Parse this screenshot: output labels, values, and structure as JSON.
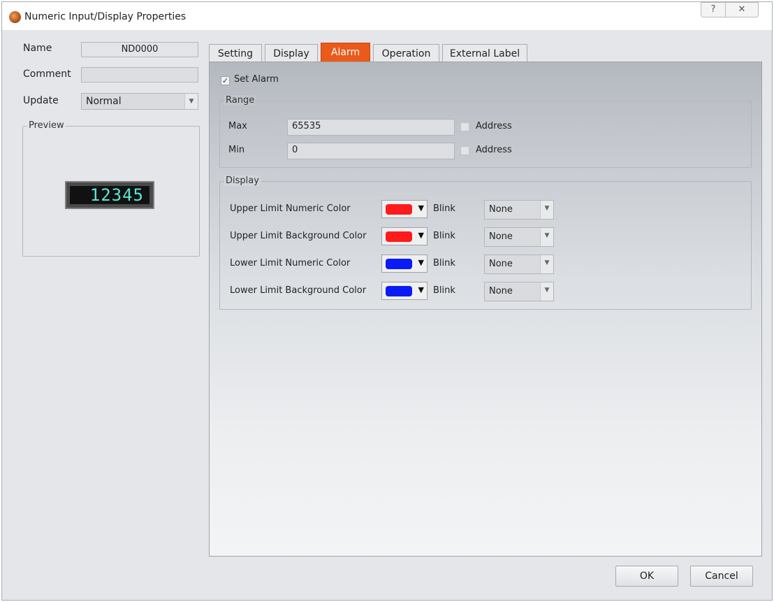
{
  "window": {
    "title": "Numeric Input/Display Properties",
    "help_glyph": "?",
    "close_glyph": "✕"
  },
  "left": {
    "name_label": "Name",
    "name_value": "ND0000",
    "comment_label": "Comment",
    "comment_value": "",
    "update_label": "Update",
    "update_value": "Normal",
    "preview_title": "Preview",
    "preview_value": "12345",
    "preview_color": "#58e7d6"
  },
  "tabs": [
    "Setting",
    "Display",
    "Alarm",
    "Operation",
    "External Label"
  ],
  "active_tab": "Alarm",
  "alarm": {
    "set_alarm_label": "Set Alarm",
    "set_alarm_checked": true,
    "range": {
      "title": "Range",
      "max_label": "Max",
      "max_value": "65535",
      "min_label": "Min",
      "min_value": "0",
      "address_label": "Address"
    },
    "display": {
      "title": "Display",
      "blink_label": "Blink",
      "rows": [
        {
          "label": "Upper Limit Numeric Color",
          "color": "#ff1b1b",
          "blink": "None"
        },
        {
          "label": "Upper Limit Background Color",
          "color": "#ff1b1b",
          "blink": "None"
        },
        {
          "label": "Lower Limit Numeric Color",
          "color": "#0a1cf5",
          "blink": "None"
        },
        {
          "label": "Lower Limit Background Color",
          "color": "#0a1cf5",
          "blink": "None"
        }
      ]
    }
  },
  "footer": {
    "ok_label": "OK",
    "cancel_label": "Cancel"
  }
}
